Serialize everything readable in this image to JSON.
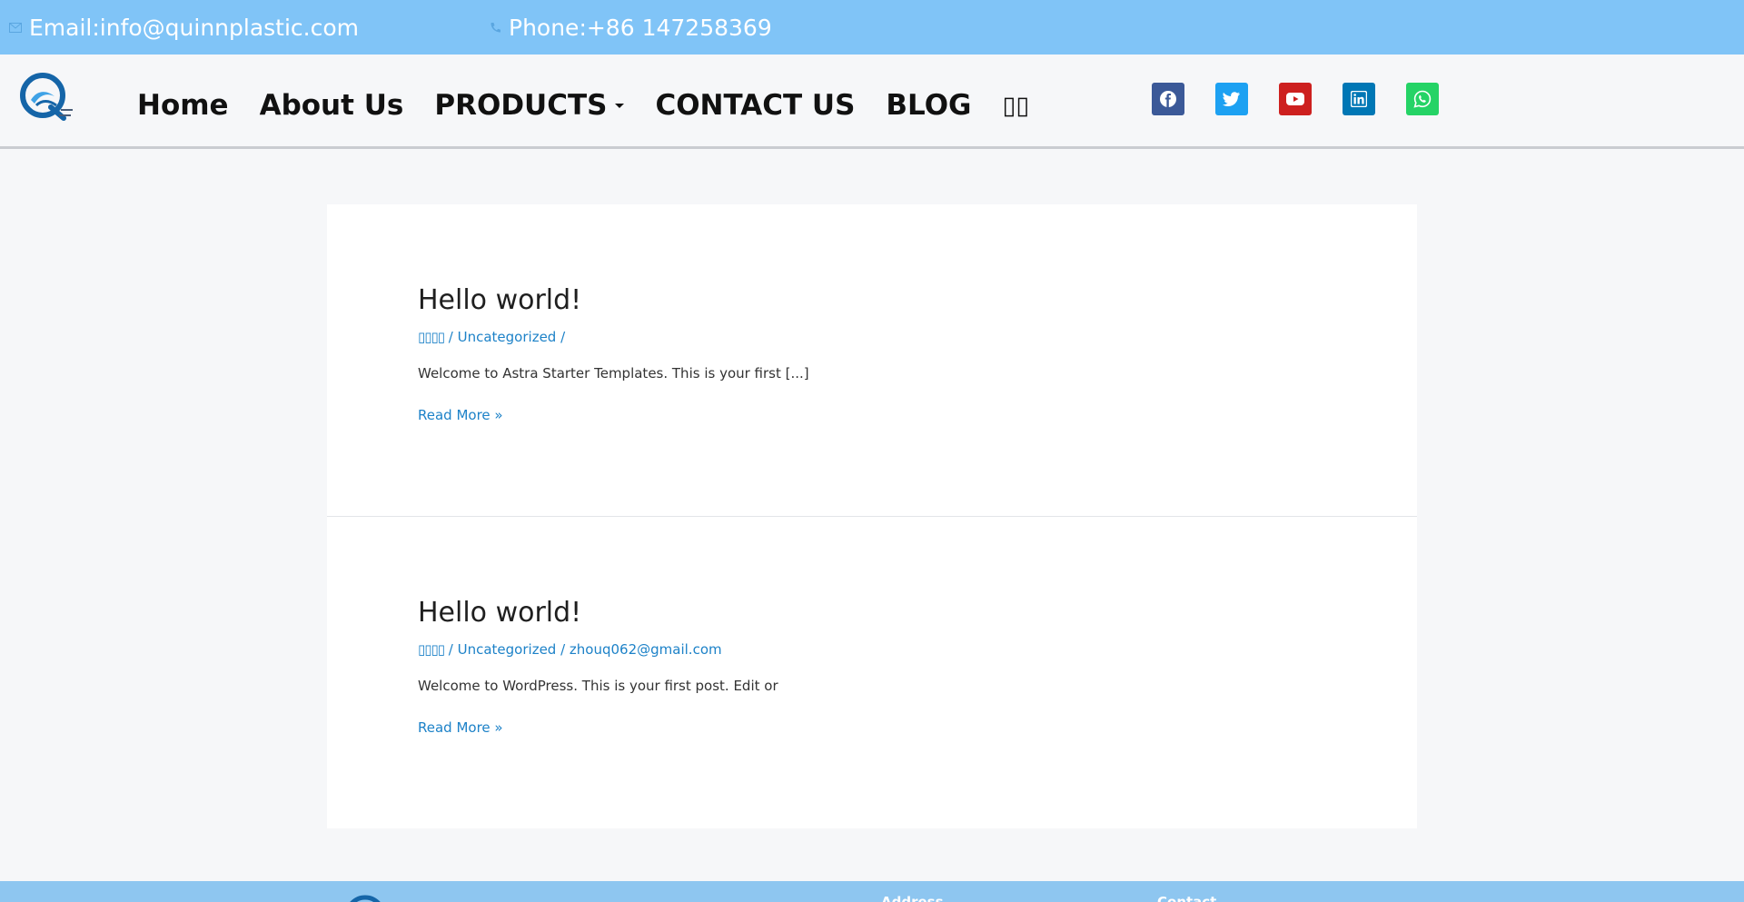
{
  "topbar": {
    "email": "Email:info@quinnplastic.com",
    "phone": "Phone:+86 147258369"
  },
  "nav": {
    "home": "Home",
    "about": "About Us",
    "products": "PRODUCTS",
    "contact": "CONTACT US",
    "blog": "BLOG",
    "language": "▯▯"
  },
  "socials": [
    {
      "name": "facebook-icon",
      "color": "#3b5998"
    },
    {
      "name": "twitter-icon",
      "color": "#1da1f2"
    },
    {
      "name": "youtube-icon",
      "color": "#cd201f"
    },
    {
      "name": "linkedin-icon",
      "color": "#0077b5"
    },
    {
      "name": "whatsapp-icon",
      "color": "#25d366"
    }
  ],
  "posts": [
    {
      "title": "Hello world!",
      "date": "▯▯▯▯",
      "category": "Uncategorized",
      "sep1": " / ",
      "sep2": " /",
      "author": "",
      "excerpt": "Welcome to Astra Starter Templates. This is your first [...]",
      "read_more": "Read More »"
    },
    {
      "title": "Hello world!",
      "date": "▯▯▯▯",
      "category": "Uncategorized",
      "sep1": " / ",
      "sep2": " / ",
      "author": "zhouq062@gmail.com",
      "excerpt": "Welcome to WordPress. This is your first post. Edit or",
      "read_more": "Read More »"
    }
  ],
  "footer": {
    "address_heading": "Address",
    "contact_heading": "Contact"
  },
  "colors": {
    "topbar": "#80c4f7",
    "link": "#1d82c8",
    "footer": "#8ec6f0"
  }
}
